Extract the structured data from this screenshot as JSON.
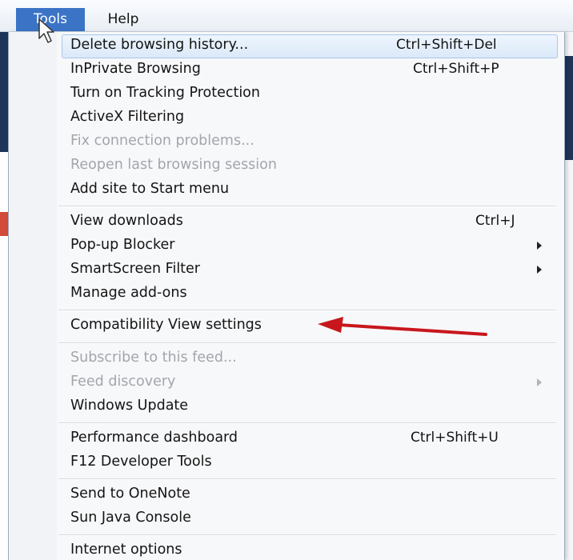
{
  "menubar": {
    "items": [
      {
        "label": "Tools",
        "active": true
      },
      {
        "label": "Help",
        "active": false
      }
    ]
  },
  "menu": {
    "items": [
      {
        "label": "Delete browsing history...",
        "shortcut": "Ctrl+Shift+Del",
        "enabled": true,
        "highlighted": true
      },
      {
        "label": "InPrivate Browsing",
        "shortcut": "Ctrl+Shift+P",
        "enabled": true
      },
      {
        "label": "Turn on Tracking Protection",
        "enabled": true
      },
      {
        "label": "ActiveX Filtering",
        "enabled": true
      },
      {
        "label": "Fix connection problems...",
        "enabled": false
      },
      {
        "label": "Reopen last browsing session",
        "enabled": false
      },
      {
        "label": "Add site to Start menu",
        "enabled": true
      },
      {
        "label": "View downloads",
        "shortcut": "Ctrl+J",
        "enabled": true
      },
      {
        "label": "Pop-up Blocker",
        "submenu": true,
        "enabled": true
      },
      {
        "label": "SmartScreen Filter",
        "submenu": true,
        "enabled": true
      },
      {
        "label": "Manage add-ons",
        "enabled": true
      },
      {
        "label": "Compatibility View settings",
        "enabled": true,
        "annotated": true
      },
      {
        "label": "Subscribe to this feed...",
        "enabled": false
      },
      {
        "label": "Feed discovery",
        "submenu": true,
        "enabled": false
      },
      {
        "label": "Windows Update",
        "enabled": true
      },
      {
        "label": "Performance dashboard",
        "shortcut": "Ctrl+Shift+U",
        "enabled": true
      },
      {
        "label": "F12 Developer Tools",
        "enabled": true
      },
      {
        "label": "Send to OneNote",
        "enabled": true
      },
      {
        "label": "Sun Java Console",
        "enabled": true
      },
      {
        "label": "Internet options",
        "enabled": true
      }
    ]
  },
  "colors": {
    "menu_active": "#3b74c6",
    "annotation_arrow": "#c8171c",
    "disabled_text": "#a2a6ab"
  },
  "icons": {
    "pointer": "mouse-pointer-icon",
    "annotation": "red-arrow-icon"
  }
}
